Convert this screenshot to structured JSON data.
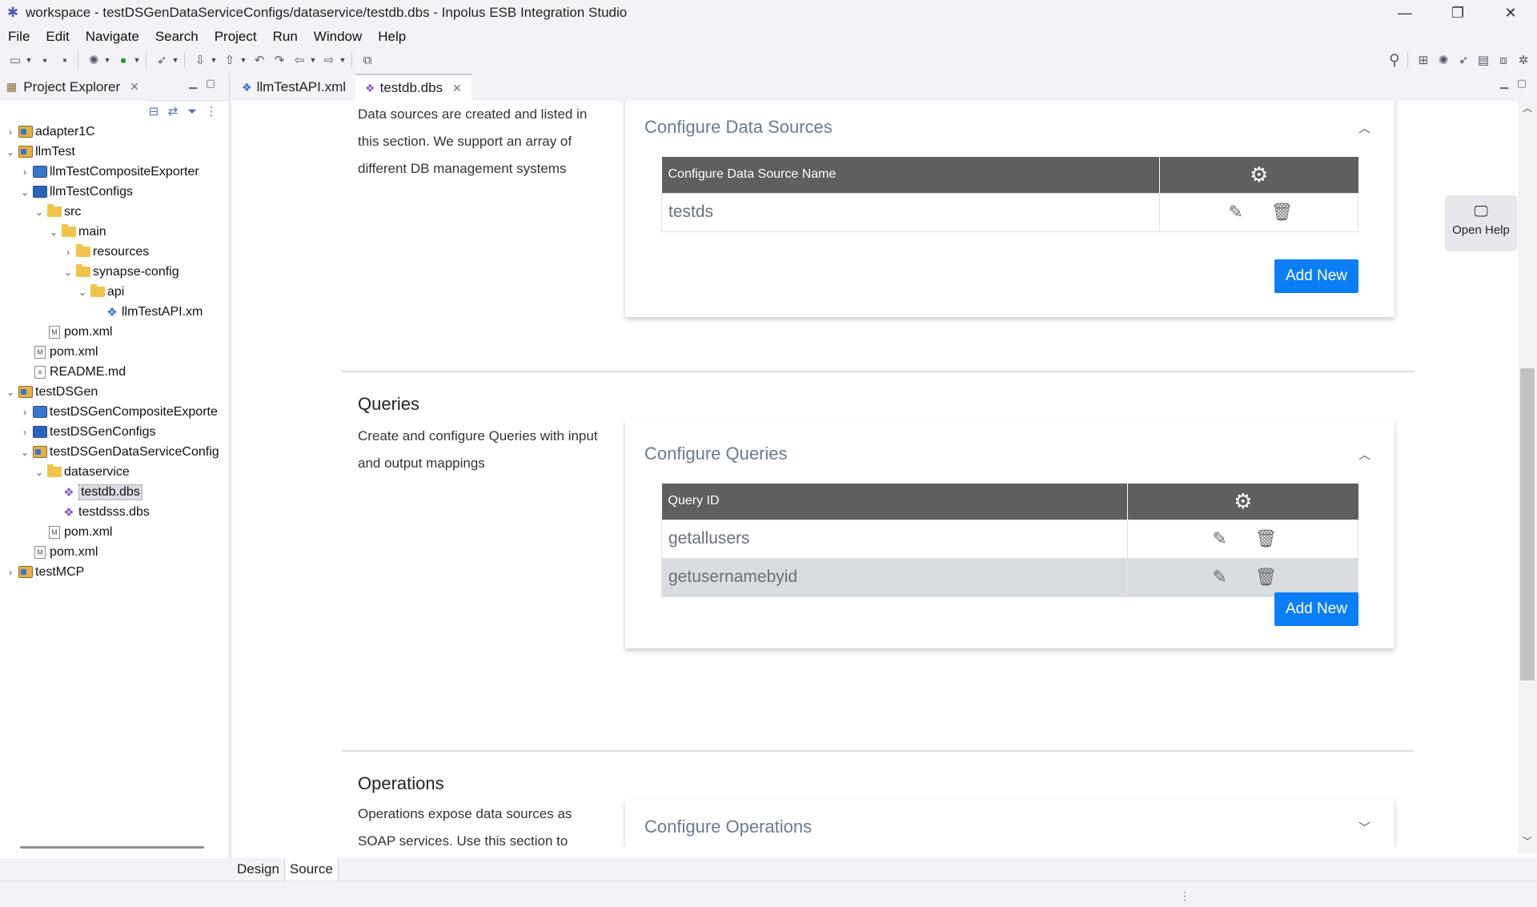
{
  "window": {
    "title": "workspace - testDSGenDataServiceConfigs/dataservice/testdb.dbs - Inpolus ESB Integration Studio",
    "minimize": "—",
    "restore": "❐",
    "close": "✕"
  },
  "menu": [
    "File",
    "Edit",
    "Navigate",
    "Search",
    "Project",
    "Run",
    "Window",
    "Help"
  ],
  "left_panel": {
    "tab_label": "Project Explorer",
    "tree": [
      {
        "label": "adapter1C",
        "depth": 0,
        "chevron": "›",
        "icon": "project-icon"
      },
      {
        "label": "llmTest",
        "depth": 0,
        "chevron": "⌄",
        "icon": "project-icon"
      },
      {
        "label": "llmTestCompositeExporter",
        "depth": 1,
        "chevron": "›",
        "icon": "composite-project-icon"
      },
      {
        "label": "llmTestConfigs",
        "depth": 1,
        "chevron": "⌄",
        "icon": "config-project-icon"
      },
      {
        "label": "src",
        "depth": 2,
        "chevron": "⌄",
        "icon": "folder-icon"
      },
      {
        "label": "main",
        "depth": 3,
        "chevron": "⌄",
        "icon": "folder-icon"
      },
      {
        "label": "resources",
        "depth": 4,
        "chevron": "›",
        "icon": "folder-icon"
      },
      {
        "label": "synapse-config",
        "depth": 4,
        "chevron": "⌄",
        "icon": "folder-icon"
      },
      {
        "label": "api",
        "depth": 5,
        "chevron": "⌄",
        "icon": "folder-icon"
      },
      {
        "label": "llmTestAPI.xm",
        "depth": 6,
        "chevron": "",
        "icon": "api-file-icon"
      },
      {
        "label": "pom.xml",
        "depth": 2,
        "chevron": "",
        "icon": "xml-file-icon"
      },
      {
        "label": "pom.xml",
        "depth": 1,
        "chevron": "",
        "icon": "xml-file-icon"
      },
      {
        "label": "README.md",
        "depth": 1,
        "chevron": "",
        "icon": "text-file-icon"
      },
      {
        "label": "testDSGen",
        "depth": 0,
        "chevron": "⌄",
        "icon": "project-icon"
      },
      {
        "label": "testDSGenCompositeExporte",
        "depth": 1,
        "chevron": "›",
        "icon": "composite-project-icon"
      },
      {
        "label": "testDSGenConfigs",
        "depth": 1,
        "chevron": "›",
        "icon": "config-project-icon"
      },
      {
        "label": "testDSGenDataServiceConfig",
        "depth": 1,
        "chevron": "⌄",
        "icon": "dataservice-project-icon"
      },
      {
        "label": "dataservice",
        "depth": 2,
        "chevron": "⌄",
        "icon": "folder-icon"
      },
      {
        "label": "testdb.dbs",
        "depth": 3,
        "chevron": "",
        "icon": "dbs-file-icon",
        "selected": true
      },
      {
        "label": "testdsss.dbs",
        "depth": 3,
        "chevron": "",
        "icon": "dbs-file-icon"
      },
      {
        "label": "pom.xml",
        "depth": 2,
        "chevron": "",
        "icon": "xml-file-icon"
      },
      {
        "label": "pom.xml",
        "depth": 1,
        "chevron": "",
        "icon": "xml-file-icon"
      },
      {
        "label": "testMCP",
        "depth": 0,
        "chevron": "›",
        "icon": "project-icon"
      }
    ]
  },
  "editor": {
    "tabs": [
      {
        "label": "llmTestAPI.xml",
        "active": false
      },
      {
        "label": "testdb.dbs",
        "active": true
      }
    ],
    "datasources": {
      "description": "Data sources are created and listed in this section. We support an array of different DB management systems",
      "card_title": "Configure Data Sources",
      "column": "Configure Data Source Name",
      "rows": [
        "testds"
      ],
      "add_label": "Add New"
    },
    "queries": {
      "title": "Queries",
      "description": "Create and configure Queries with input and output mappings",
      "card_title": "Configure Queries",
      "column": "Query ID",
      "rows": [
        "getallusers",
        "getusernamebyid"
      ],
      "add_label": "Add New"
    },
    "operations": {
      "title": "Operations",
      "description": "Operations expose data sources as SOAP services. Use this section to",
      "card_title": "Configure Operations"
    },
    "help_label": "Open Help",
    "bottom_tabs": [
      "Design",
      "Source"
    ]
  },
  "colors": {
    "accent_button": "#0b7ef5",
    "table_header": "#5d5f61",
    "card_title": "#6a7b90"
  }
}
